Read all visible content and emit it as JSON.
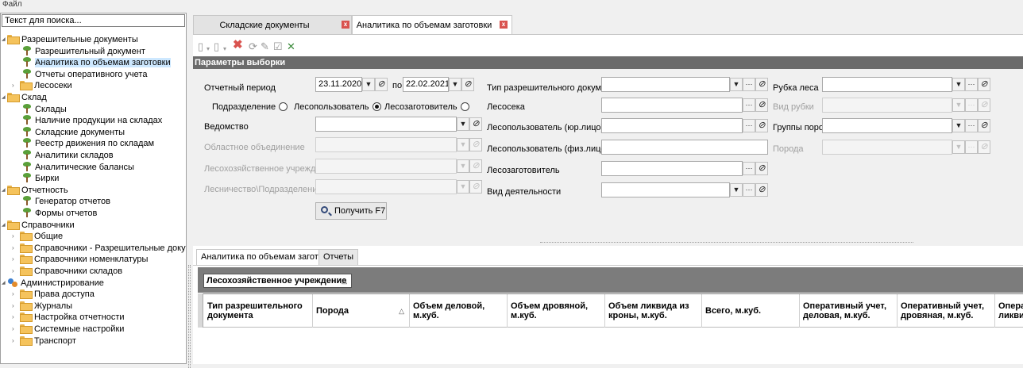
{
  "menubar": {
    "file": "Файл"
  },
  "search": {
    "placeholder": "Текст для поиска..."
  },
  "tree": [
    {
      "label": "Разрешительные документы",
      "level": 0,
      "icon": "folder",
      "expanded": true
    },
    {
      "label": "Разрешительный документ",
      "level": 1,
      "icon": "leaf"
    },
    {
      "label": "Аналитика по объемам заготовки",
      "level": 1,
      "icon": "leaf",
      "selected": true
    },
    {
      "label": "Отчеты оперативного учета",
      "level": 1,
      "icon": "leaf"
    },
    {
      "label": "Лесосеки",
      "level": 1,
      "icon": "folder",
      "expanded": false
    },
    {
      "label": "Склад",
      "level": 0,
      "icon": "folder",
      "expanded": true
    },
    {
      "label": "Склады",
      "level": 1,
      "icon": "leaf"
    },
    {
      "label": "Наличие продукции на складах",
      "level": 1,
      "icon": "leaf"
    },
    {
      "label": "Складские документы",
      "level": 1,
      "icon": "leaf"
    },
    {
      "label": "Реестр движения по складам",
      "level": 1,
      "icon": "leaf"
    },
    {
      "label": "Аналитики складов",
      "level": 1,
      "icon": "leaf"
    },
    {
      "label": "Аналитические балансы",
      "level": 1,
      "icon": "leaf"
    },
    {
      "label": "Бирки",
      "level": 1,
      "icon": "leaf"
    },
    {
      "label": "Отчетность",
      "level": 0,
      "icon": "folder",
      "expanded": true
    },
    {
      "label": "Генератор отчетов",
      "level": 1,
      "icon": "leaf"
    },
    {
      "label": "Формы отчетов",
      "level": 1,
      "icon": "leaf"
    },
    {
      "label": "Справочники",
      "level": 0,
      "icon": "folder",
      "expanded": true
    },
    {
      "label": "Общие",
      "level": 1,
      "icon": "folder",
      "expanded": false
    },
    {
      "label": "Справочники - Разрешительные документы",
      "level": 1,
      "icon": "folder",
      "expanded": false
    },
    {
      "label": "Справочники номенклатуры",
      "level": 1,
      "icon": "folder",
      "expanded": false
    },
    {
      "label": "Справочники складов",
      "level": 1,
      "icon": "folder",
      "expanded": false
    },
    {
      "label": "Администрирование",
      "level": 0,
      "icon": "gear",
      "expanded": true
    },
    {
      "label": "Права доступа",
      "level": 1,
      "icon": "folder",
      "expanded": false
    },
    {
      "label": "Журналы",
      "level": 1,
      "icon": "folder",
      "expanded": false
    },
    {
      "label": "Настройка отчетности",
      "level": 1,
      "icon": "folder",
      "expanded": false
    },
    {
      "label": "Системные настройки",
      "level": 1,
      "icon": "folder",
      "expanded": false
    },
    {
      "label": "Транспорт",
      "level": 1,
      "icon": "folder",
      "expanded": false
    }
  ],
  "tabs": [
    {
      "label": "Складские документы",
      "active": false
    },
    {
      "label": "Аналитика по объемам заготовки",
      "active": true
    }
  ],
  "params_header": "Параметры выборки",
  "form": {
    "period_label": "Отчетный период",
    "date_from": "23.11.2020",
    "po": "по",
    "date_to": "22.02.2021",
    "radio_podrazdelenie": "Подразделение",
    "radio_lesopolzovatel": "Лесопользователь",
    "radio_lesozagotovitel": "Лесозаготовитель",
    "radio_selected": "Лесопользователь",
    "vedomstvo": "Ведомство",
    "oblast": "Областное объединение",
    "leshoz": "Лесохозяйственное учреждение",
    "lesnichestvo": "Лесничество\\Подразделение",
    "tip_doc": "Тип разрешительного документа",
    "lesoseka": "Лесосека",
    "lesopolz_ur": "Лесопользователь (юр.лицо)",
    "lesopolz_fiz": "Лесопользователь (физ.лицо)",
    "lesozag": "Лесозаготовитель",
    "vid_deyat": "Вид деятельности",
    "rubka": "Рубка леса",
    "vid_rubki": "Вид рубки",
    "gruppy_porod": "Группы пород",
    "poroda": "Порода",
    "get_button": "Получить F7"
  },
  "bottom_tabs": [
    {
      "label": "Аналитика по объемам заготовки",
      "active": true
    },
    {
      "label": "Отчеты",
      "active": false
    }
  ],
  "group_chip": "Лесохозяйственное учреждение",
  "grid_columns": [
    "Тип разрешительного документа",
    "Порода",
    "Объем деловой, м.куб.",
    "Объем дровяной, м.куб.",
    "Объем ликвида из кроны, м.куб.",
    "Всего, м.куб.",
    "Оперативный учет, деловая, м.куб.",
    "Оперативный учет, дровяная, м.куб.",
    "Операт ликвид"
  ],
  "icons": {
    "sort": "△",
    "dropdown": "▼",
    "ellipsis": "···",
    "edit": "pencil-icon",
    "close": "x-icon",
    "clear": "pencil-icon"
  }
}
